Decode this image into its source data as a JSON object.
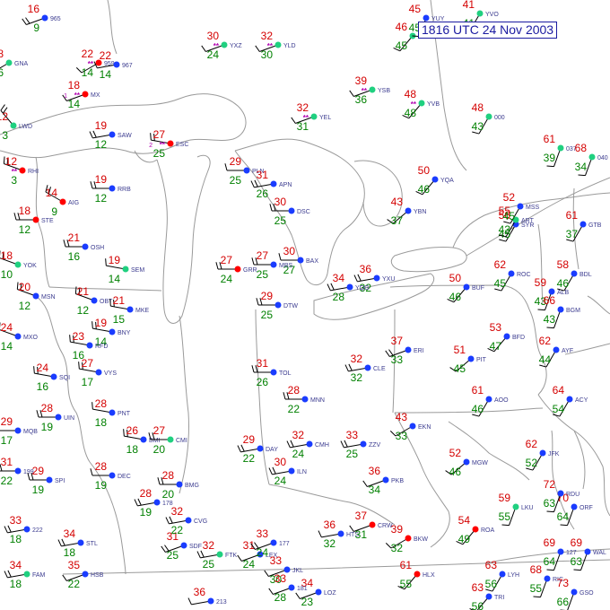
{
  "timestamp": "1816 UTC 24 Nov 2003",
  "colors": {
    "background": "#ffffff",
    "map_lines": "#9a9a9a",
    "temperature": "#d40000",
    "dewpoint": "#008000",
    "station_id": "#3b3b8f",
    "pressure": "#3b3b8f",
    "weather_symbol": "#b000b0",
    "wind_barb": "#000000",
    "timestamp_text": "#1a1aa0"
  },
  "sky_cover_colors": {
    "clear": "#20d080",
    "scattered": "#1a3cff",
    "overcast": "#ff0000"
  },
  "stations": [
    {
      "id": "GNA",
      "t": "18",
      "td": "6",
      "sky": "clear",
      "dir": 240,
      "kt": 10
    },
    {
      "id": "965",
      "t": "16",
      "td": "9",
      "sky": "scattered",
      "dir": 250,
      "kt": 15
    },
    {
      "id": "959",
      "t": "22",
      "td": "14",
      "sky": "overcast",
      "dir": 240,
      "kt": 10,
      "wx": "**"
    },
    {
      "id": "967",
      "t": "22",
      "td": "14",
      "sky": "scattered",
      "dir": 260,
      "kt": 10
    },
    {
      "id": "MX",
      "t": "18",
      "td": "14",
      "sky": "overcast",
      "dir": 250,
      "kt": 10,
      "wx": "**",
      "vis": "1"
    },
    {
      "id": "LWD",
      "t": "12",
      "td": "3",
      "sky": "clear",
      "dir": 320,
      "kt": 15
    },
    {
      "id": "SAW",
      "t": "19",
      "td": "12",
      "sky": "scattered",
      "dir": 260,
      "kt": 15
    },
    {
      "id": "ESC",
      "t": "27",
      "td": "25",
      "sky": "overcast",
      "dir": 280,
      "kt": 20,
      "wx": "**",
      "vis": "2"
    },
    {
      "id": "RHI",
      "t": "12",
      "td": "3",
      "sky": "overcast",
      "dir": 290,
      "kt": 20,
      "wx": "**"
    },
    {
      "id": "AIG",
      "t": "14",
      "td": "9",
      "sky": "overcast",
      "dir": 300,
      "kt": 20
    },
    {
      "id": "RRB",
      "t": "19",
      "td": "12",
      "sky": "scattered",
      "dir": 270,
      "kt": 15
    },
    {
      "id": "STE",
      "t": "18",
      "td": "12",
      "sky": "overcast",
      "dir": 270,
      "kt": 15
    },
    {
      "id": "OSH",
      "t": "21",
      "td": "16",
      "sky": "scattered",
      "dir": 270,
      "kt": 15
    },
    {
      "id": "YOK",
      "t": "18",
      "td": "10",
      "sky": "clear",
      "dir": 290,
      "kt": 15
    },
    {
      "id": "SEM",
      "t": "19",
      "td": "14",
      "sky": "clear",
      "dir": 280,
      "kt": 10
    },
    {
      "id": "OBT",
      "t": "21",
      "td": "12",
      "sky": "scattered",
      "dir": 290,
      "kt": 15
    },
    {
      "id": "MKE",
      "t": "21",
      "td": "15",
      "sky": "scattered",
      "dir": 280,
      "kt": 15
    },
    {
      "id": "MSN",
      "t": "20",
      "td": "12",
      "sky": "scattered",
      "dir": 290,
      "kt": 15
    },
    {
      "id": "BNY",
      "t": "19",
      "td": "14",
      "sky": "scattered",
      "dir": 280,
      "kt": 15
    },
    {
      "id": "MXO",
      "t": "24",
      "td": "14",
      "sky": "scattered",
      "dir": 290,
      "kt": 10
    },
    {
      "id": "RFD",
      "t": "23",
      "td": "16",
      "sky": "scattered",
      "dir": 280,
      "kt": 15
    },
    {
      "id": "SQI",
      "t": "24",
      "td": "16",
      "sky": "scattered",
      "dir": 280,
      "kt": 15
    },
    {
      "id": "VYS",
      "t": "27",
      "td": "17",
      "sky": "scattered",
      "dir": 280,
      "kt": 15
    },
    {
      "id": "PNT",
      "t": "28",
      "td": "18",
      "sky": "scattered",
      "dir": 280,
      "kt": 10
    },
    {
      "id": "UIN",
      "t": "28",
      "td": "19",
      "sky": "scattered",
      "dir": 270,
      "kt": 15
    },
    {
      "id": "MQB",
      "t": "29",
      "td": "17",
      "sky": "scattered",
      "dir": 270,
      "kt": 10
    },
    {
      "id": "BMI",
      "t": "26",
      "td": "18",
      "sky": "scattered",
      "dir": 280,
      "kt": 15
    },
    {
      "id": "CMI",
      "t": "27",
      "td": "20",
      "sky": "clear",
      "dir": 270,
      "kt": 15
    },
    {
      "id": "199",
      "t": "31",
      "td": "22",
      "sky": "scattered",
      "dir": 270,
      "kt": 15
    },
    {
      "id": "SPI",
      "t": "29",
      "td": "19",
      "sky": "scattered",
      "dir": 270,
      "kt": 15
    },
    {
      "id": "DEC",
      "t": "28",
      "td": "19",
      "sky": "scattered",
      "dir": 270,
      "kt": 10
    },
    {
      "id": "BMG",
      "t": "28",
      "td": "20",
      "sky": "scattered",
      "dir": 270,
      "kt": 15
    },
    {
      "id": "178",
      "t": "28",
      "td": "19",
      "sky": "scattered",
      "dir": 260,
      "kt": 15
    },
    {
      "id": "222",
      "t": "33",
      "td": "18",
      "sky": "scattered",
      "dir": 260,
      "kt": 15
    },
    {
      "id": "STL",
      "t": "34",
      "td": "18",
      "sky": "scattered",
      "dir": 260,
      "kt": 15
    },
    {
      "id": "FAM",
      "t": "34",
      "td": "18",
      "sky": "clear",
      "dir": 260,
      "kt": 15
    },
    {
      "id": "HSB",
      "t": "35",
      "td": "22",
      "sky": "scattered",
      "dir": 250,
      "kt": 10
    },
    {
      "id": "FTK",
      "t": "32",
      "td": "25",
      "sky": "clear",
      "dir": 260,
      "kt": 15
    },
    {
      "id": "SDF",
      "t": "31",
      "td": "25",
      "sky": "scattered",
      "dir": 250,
      "kt": 15
    },
    {
      "id": "LEX",
      "t": "31",
      "td": "24",
      "sky": "scattered",
      "dir": 250,
      "kt": 10
    },
    {
      "id": "177",
      "t": "33",
      "td": "24",
      "sky": "scattered",
      "dir": 250,
      "kt": 15
    },
    {
      "id": "JKL",
      "t": "33",
      "td": "30",
      "sky": "scattered",
      "dir": 250,
      "kt": 10
    },
    {
      "id": "CVG",
      "t": "32",
      "td": "22",
      "sky": "scattered",
      "dir": 260,
      "kt": 15
    },
    {
      "id": "ILN",
      "t": "30",
      "td": "24",
      "sky": "scattered",
      "dir": 260,
      "kt": 15
    },
    {
      "id": "DAY",
      "t": "29",
      "td": "22",
      "sky": "scattered",
      "dir": 260,
      "kt": 15
    },
    {
      "id": "CMH",
      "t": "32",
      "td": "24",
      "sky": "scattered",
      "dir": 260,
      "kt": 15
    },
    {
      "id": "ZZV",
      "t": "33",
      "td": "25",
      "sky": "scattered",
      "dir": 260,
      "kt": 15
    },
    {
      "id": "PKB",
      "t": "36",
      "td": "34",
      "sky": "scattered",
      "dir": 250,
      "kt": 10
    },
    {
      "id": "HTS",
      "t": "36",
      "td": "32",
      "sky": "scattered",
      "dir": 260,
      "kt": 10
    },
    {
      "id": "CRW",
      "t": "37",
      "td": "31",
      "sky": "overcast",
      "dir": 250,
      "kt": 10
    },
    {
      "id": "BKW",
      "t": "39",
      "td": "32",
      "sky": "overcast",
      "dir": 240,
      "kt": 10
    },
    {
      "id": "LOZ",
      "t": "34",
      "td": "23",
      "sky": "scattered",
      "dir": 250,
      "kt": 10
    },
    {
      "id": "181",
      "t": "33",
      "td": "28",
      "sky": "scattered",
      "dir": 250,
      "kt": 10
    },
    {
      "id": "213",
      "t": "36",
      "td": "",
      "sky": "scattered",
      "dir": 260,
      "kt": 10
    },
    {
      "id": "YXZ",
      "t": "30",
      "td": "24",
      "sky": "clear",
      "dir": 250,
      "kt": 10,
      "wx": "**"
    },
    {
      "id": "YLD",
      "t": "32",
      "td": "30",
      "sky": "clear",
      "dir": 250,
      "kt": 10,
      "wx": "**"
    },
    {
      "id": "PLN",
      "t": "29",
      "td": "25",
      "sky": "scattered",
      "dir": 270,
      "kt": 10
    },
    {
      "id": "APN",
      "t": "31",
      "td": "26",
      "sky": "scattered",
      "dir": 260,
      "kt": 15
    },
    {
      "id": "YEL",
      "t": "32",
      "td": "31",
      "sky": "clear",
      "dir": 250,
      "kt": 10,
      "wx": "**"
    },
    {
      "id": "YSB",
      "t": "39",
      "td": "36",
      "sky": "clear",
      "dir": 250,
      "kt": 10,
      "wx": "**"
    },
    {
      "id": "YVB",
      "t": "48",
      "td": "48",
      "sky": "clear",
      "dir": 220,
      "kt": 10,
      "wx": "**"
    },
    {
      "id": "YVV",
      "t": "46",
      "td": "45",
      "sky": "clear",
      "dir": 220,
      "kt": 10
    },
    {
      "id": "YQA",
      "t": "50",
      "td": "46",
      "sky": "scattered",
      "dir": 220,
      "kt": 10
    },
    {
      "id": "YBN",
      "t": "43",
      "td": "37",
      "sky": "scattered",
      "dir": 230,
      "kt": 10
    },
    {
      "id": "YXU",
      "t": "36",
      "td": "32",
      "sky": "scattered",
      "dir": 260,
      "kt": 15
    },
    {
      "id": "BAX",
      "t": "30",
      "td": "27",
      "sky": "scattered",
      "dir": 270,
      "kt": 10
    },
    {
      "id": "MBS",
      "t": "27",
      "td": "25",
      "sky": "scattered",
      "dir": 270,
      "kt": 15
    },
    {
      "id": "DSC",
      "t": "30",
      "td": "25",
      "sky": "scattered",
      "dir": 270,
      "kt": 15
    },
    {
      "id": "GRR",
      "t": "27",
      "td": "24",
      "sky": "overcast",
      "dir": 270,
      "kt": 15
    },
    {
      "id": "TOL",
      "t": "31",
      "td": "26",
      "sky": "scattered",
      "dir": 270,
      "kt": 15
    },
    {
      "id": "DTW",
      "t": "29",
      "td": "25",
      "sky": "scattered",
      "dir": 270,
      "kt": 15
    },
    {
      "id": "YQG",
      "t": "34",
      "td": "28",
      "sky": "scattered",
      "dir": 260,
      "kt": 15
    },
    {
      "id": "MNN",
      "t": "28",
      "td": "22",
      "sky": "scattered",
      "dir": 270,
      "kt": 15
    },
    {
      "id": "CLE",
      "t": "32",
      "td": "32",
      "sky": "scattered",
      "dir": 260,
      "kt": 15
    },
    {
      "id": "ERI",
      "t": "37",
      "td": "33",
      "sky": "scattered",
      "dir": 250,
      "kt": 15
    },
    {
      "id": "BUF",
      "t": "50",
      "td": "46",
      "sky": "scattered",
      "dir": 220,
      "kt": 10
    },
    {
      "id": "ROC",
      "t": "62",
      "td": "45",
      "sky": "scattered",
      "dir": 210,
      "kt": 10
    },
    {
      "id": "SYR",
      "t": "56",
      "td": "45",
      "sky": "scattered",
      "dir": 210,
      "kt": 10
    },
    {
      "id": "ALB",
      "t": "59",
      "td": "43",
      "sky": "scattered",
      "dir": 200,
      "kt": 10
    },
    {
      "id": "BGM",
      "t": "66",
      "td": "43",
      "sky": "scattered",
      "dir": 200,
      "kt": 10
    },
    {
      "id": "BFD",
      "t": "53",
      "td": "47",
      "sky": "scattered",
      "dir": 220,
      "kt": 10
    },
    {
      "id": "PIT",
      "t": "51",
      "td": "45",
      "sky": "scattered",
      "dir": 230,
      "kt": 10
    },
    {
      "id": "AOO",
      "t": "61",
      "td": "46",
      "sky": "scattered",
      "dir": 210,
      "kt": 10
    },
    {
      "id": "AYF",
      "t": "62",
      "td": "44",
      "sky": "scattered",
      "dir": 210,
      "kt": 10
    },
    {
      "id": "EKN",
      "t": "43",
      "td": "33",
      "sky": "scattered",
      "dir": 240,
      "kt": 10
    },
    {
      "id": "MGW",
      "t": "52",
      "td": "46",
      "sky": "scattered",
      "dir": 230,
      "kt": 10
    },
    {
      "id": "LKU",
      "t": "59",
      "td": "55",
      "sky": "clear",
      "dir": 200,
      "kt": 10
    },
    {
      "id": "ROA",
      "t": "54",
      "td": "49",
      "sky": "overcast",
      "dir": 220,
      "kt": 10
    },
    {
      "id": "RIC",
      "t": "68",
      "td": "55",
      "sky": "scattered",
      "dir": 200,
      "kt": 10
    },
    {
      "id": "ORF",
      "t": "70",
      "td": "64",
      "sky": "scattered",
      "dir": 200,
      "kt": 10
    },
    {
      "id": "127",
      "t": "69",
      "td": "64",
      "sky": "scattered",
      "dir": 200,
      "kt": 10
    },
    {
      "id": "WAL",
      "t": "69",
      "td": "63",
      "sky": "scattered",
      "dir": 200,
      "kt": 10
    },
    {
      "id": "ACY",
      "t": "64",
      "td": "54",
      "sky": "scattered",
      "dir": 210,
      "kt": 10
    },
    {
      "id": "JFK",
      "t": "62",
      "td": "52",
      "sky": "scattered",
      "dir": 210,
      "kt": 10
    },
    {
      "id": "BDL",
      "t": "58",
      "td": "46",
      "sky": "scattered",
      "dir": 210,
      "kt": 10
    },
    {
      "id": "LYH",
      "t": "63",
      "td": "56",
      "sky": "scattered",
      "dir": 210,
      "kt": 10
    },
    {
      "id": "GSO",
      "t": "73",
      "td": "66",
      "sky": "scattered",
      "dir": 200,
      "kt": 10
    },
    {
      "id": "RDU",
      "t": "72",
      "td": "63",
      "sky": "scattered",
      "dir": 200,
      "kt": 10
    },
    {
      "id": "HLX",
      "t": "61",
      "td": "55",
      "sky": "overcast",
      "dir": 220,
      "kt": 10
    },
    {
      "id": "TRI",
      "t": "63",
      "td": "56",
      "sky": "scattered",
      "dir": 220,
      "kt": 10
    },
    {
      "id": "YUY",
      "t": "45",
      "td": "45",
      "sky": "scattered",
      "dir": 200,
      "kt": 10
    },
    {
      "id": "YVO",
      "t": "41",
      "td": "41",
      "sky": "clear",
      "dir": 210,
      "kt": 10
    },
    {
      "id": "000",
      "t": "48",
      "td": "43",
      "sky": "clear",
      "dir": 210,
      "kt": 10
    },
    {
      "id": "037",
      "t": "61",
      "td": "39",
      "sky": "clear",
      "dir": 200,
      "kt": 10
    },
    {
      "id": "040",
      "t": "68",
      "td": "34",
      "sky": "clear",
      "dir": 200,
      "kt": 10
    },
    {
      "id": "GTB",
      "t": "61",
      "td": "37",
      "sky": "scattered",
      "dir": 210,
      "kt": 10
    },
    {
      "id": "ART",
      "t": "55",
      "td": "43",
      "sky": "clear",
      "dir": 210,
      "kt": 10
    },
    {
      "id": "MSS",
      "t": "52",
      "td": "45",
      "sky": "scattered",
      "dir": 210,
      "kt": 10
    }
  ]
}
